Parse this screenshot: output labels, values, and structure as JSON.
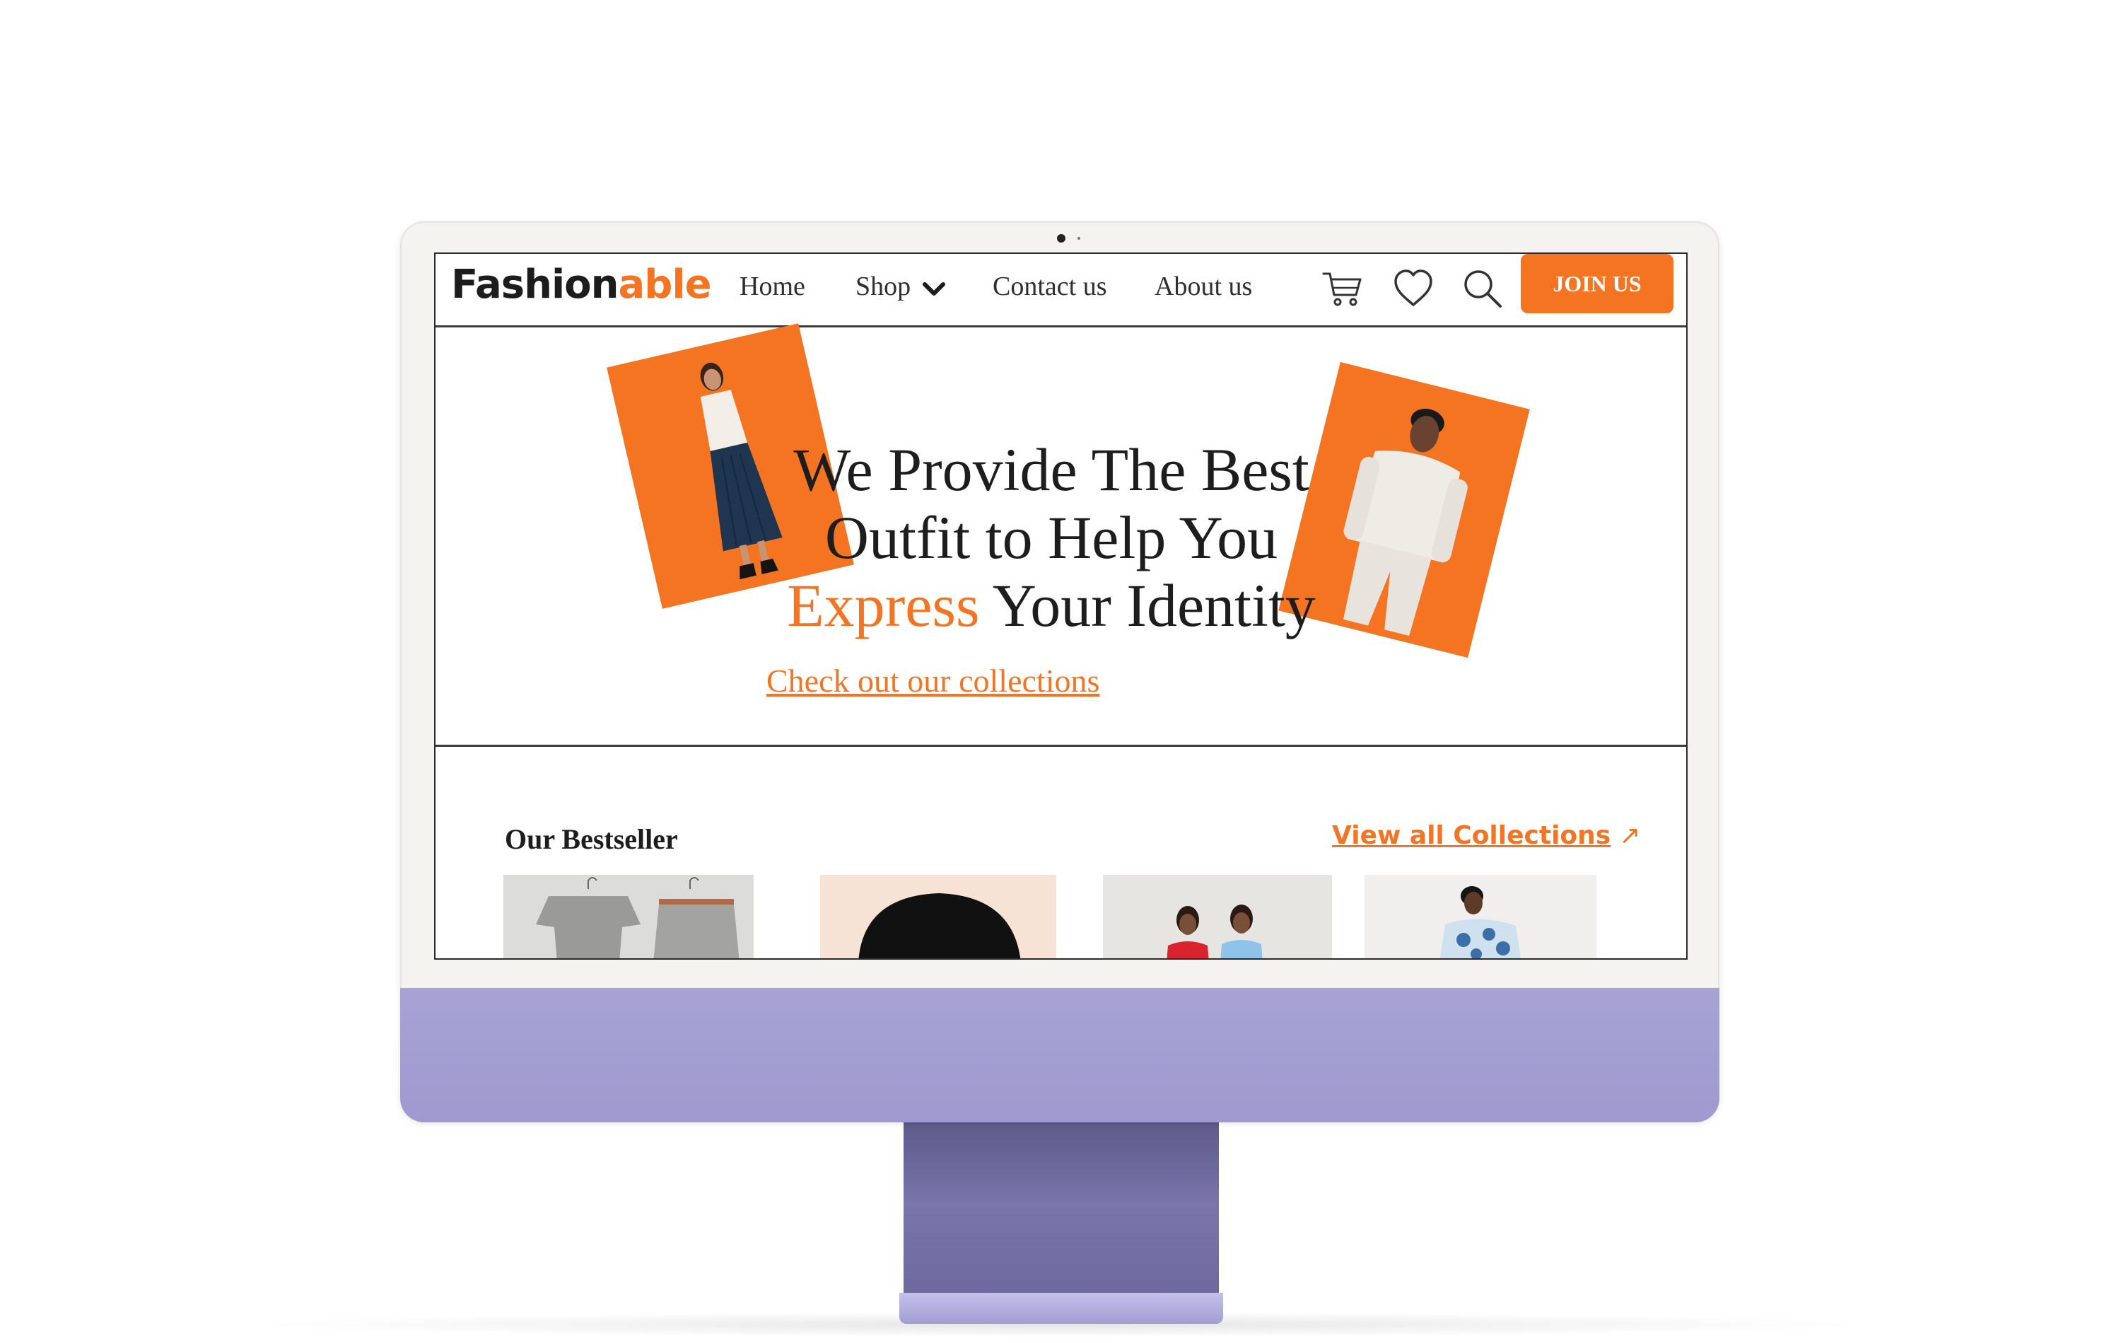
{
  "brand": {
    "name_part1": "Fashion",
    "name_part2": "able"
  },
  "nav": {
    "home": "Home",
    "shop": "Shop",
    "contact": "Contact us",
    "about": "About us"
  },
  "icons": {
    "cart": "cart-icon",
    "wishlist": "heart-icon",
    "search": "search-icon",
    "shop_dropdown": "chevron-down-icon"
  },
  "join_button": "JOIN US",
  "hero": {
    "line1": "We Provide The Best",
    "line2": "Outfit to Help You",
    "line3_accent": "Express",
    "line3_rest": " Your Identity",
    "cta_link": "Check out our collections"
  },
  "bestseller": {
    "title": "Our Bestseller",
    "view_all": "View all Collections",
    "view_all_arrow": "↗",
    "products": [
      "grey-tracksuit-image",
      "black-cap-image",
      "women-blazers-image",
      "man-printed-shirt-image"
    ]
  },
  "colors": {
    "accent": "#f47422",
    "text": "#1d1d1d",
    "monitor_chin": "#a7a3d5",
    "stand": "#6c679c"
  }
}
